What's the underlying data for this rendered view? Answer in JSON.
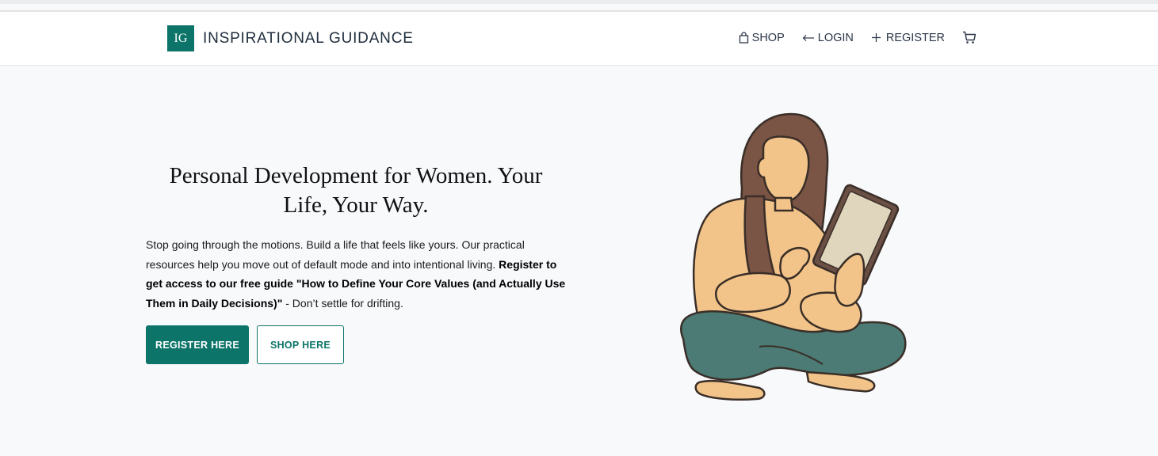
{
  "brand": {
    "logo_initials": "IG",
    "name": "INSPIRATIONAL GUIDANCE"
  },
  "nav": {
    "shop": "SHOP",
    "login": "LOGIN",
    "register": "REGISTER",
    "cart_icon": "cart-icon"
  },
  "hero": {
    "headline": "Personal Development for Women. Your Life, Your Way.",
    "description_plain": "Stop going through the motions. Build a life that feels like yours. Our practical resources help you move out of default mode and into intentional living.",
    "description_bold": "Register to get access to our free guide \"How to Define Your Core Values (and Actually Use Them in Daily Decisions)\"",
    "description_tail": " - Don’t settle for drifting.",
    "primary_button": "REGISTER HERE",
    "secondary_button": "SHOP HERE",
    "illustration": "woman-reading-tablet-illustration"
  },
  "colors": {
    "accent": "#0c7468",
    "background": "#f8f9fb",
    "header_bg": "#ffffff",
    "hair": "#7a5444",
    "skin": "#f2c489",
    "pants": "#4b7b74",
    "tablet": "#e0d5bd"
  }
}
